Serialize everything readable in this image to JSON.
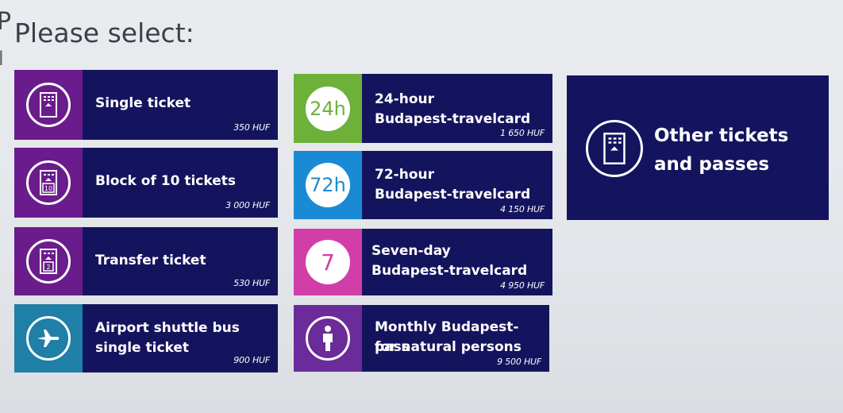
{
  "page": {
    "title": "Please select:",
    "ghost_text": "Pl"
  },
  "tickets": [
    {
      "name_line1": "Single ticket",
      "name_line2": "",
      "price": "350 HUF",
      "icon": "ticket-icon"
    },
    {
      "name_line1": "Block of 10 tickets",
      "name_line2": "",
      "price": "3 000 HUF",
      "icon": "ticket-10-icon"
    },
    {
      "name_line1": "Transfer ticket",
      "name_line2": "",
      "price": "530 HUF",
      "icon": "transfer-ticket-icon"
    },
    {
      "name_line1": "Airport shuttle bus",
      "name_line2": "single ticket",
      "price": "900 HUF",
      "icon": "airplane-icon"
    }
  ],
  "travelcards": [
    {
      "badge": "24h",
      "name_line1": "24-hour",
      "name_line2": "Budapest-travelcard",
      "price": "1 650 HUF",
      "accent": "#6db13a"
    },
    {
      "badge": "72h",
      "name_line1": "72-hour",
      "name_line2": "Budapest-travelcard",
      "price": "4 150 HUF",
      "accent": "#1a8ad4"
    },
    {
      "badge": "7",
      "name_line1": "Seven-day",
      "name_line2": "Budapest-travelcard",
      "price": "4 950 HUF",
      "accent": "#d23ea8"
    },
    {
      "badge": "",
      "name_line1": "Monthly Budapest-pass",
      "name_line2": "for natural persons",
      "price": "9 500 HUF",
      "accent": "#6b2b9a",
      "icon": "person-icon"
    }
  ],
  "other": {
    "line1": "Other tickets",
    "line2": "and passes",
    "icon": "ticket-icon"
  },
  "colors": {
    "tile_bg": "#14145e",
    "purple": "#6a1c8c",
    "teal": "#1f7fa6"
  }
}
